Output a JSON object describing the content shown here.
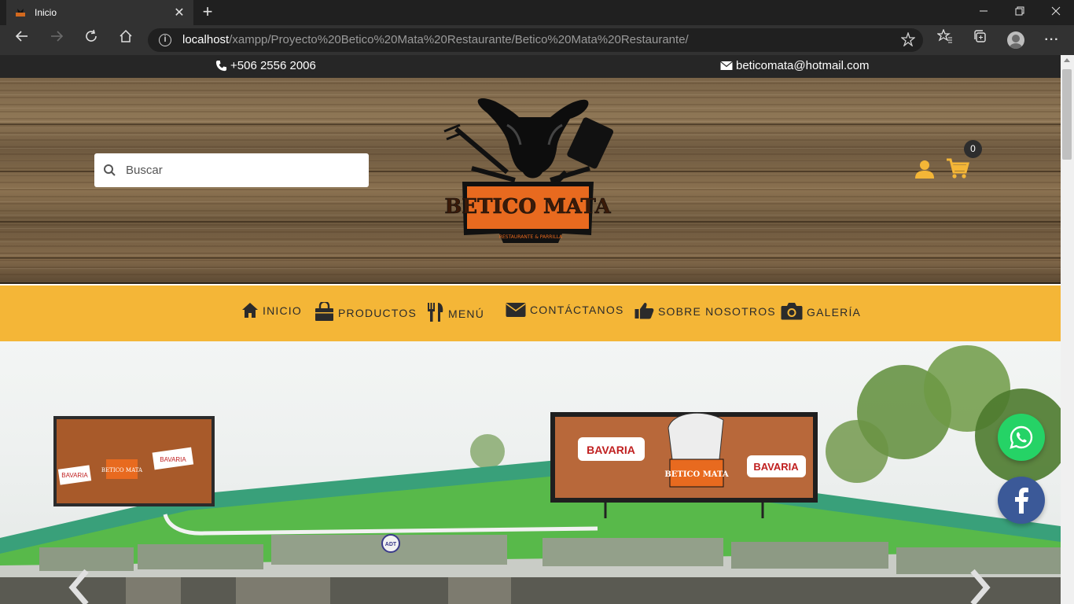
{
  "browser": {
    "tab_title": "Inicio",
    "tab_close": "✕",
    "new_tab": "+",
    "window_controls": {
      "minimize": "—",
      "restore": "❐",
      "close": "✕"
    },
    "nav": {
      "back": "←",
      "forward": "→",
      "reload": "↻",
      "home": "⌂",
      "favorites": "☆",
      "collections": "⧉",
      "more": "···"
    },
    "url_host": "localhost",
    "url_path": "/xampp/Proyecto%20Betico%20Mata%20Restaurante/Betico%20Mata%20Restaurante/",
    "url_info_icon": "i",
    "add_favorite": "☆"
  },
  "topbar": {
    "phone": "+506 2556 2006",
    "email": "beticomata@hotmail.com"
  },
  "header": {
    "search_placeholder": "Buscar",
    "logo_text": "BETICO MATA",
    "logo_subtext": "RESTAURANTE & PARRILLA",
    "cart_count": "0"
  },
  "menu": {
    "items": [
      {
        "label": "INICIO",
        "icon": "home-icon"
      },
      {
        "label": "PRODUCTOS",
        "icon": "shopping-bag-icon"
      },
      {
        "label": "MENÚ",
        "icon": "utensils-icon"
      },
      {
        "label": "CONTÁCTANOS",
        "icon": "envelope-icon"
      },
      {
        "label": "SOBRE NOSOTROS",
        "icon": "thumbs-up-icon"
      },
      {
        "label": "GALERÍA",
        "icon": "camera-icon"
      }
    ]
  },
  "hero": {
    "sign_brand_left": "BAVARIA",
    "sign_brand_right": "BAVARIA",
    "sign_logo": "BETICO MATA",
    "small_sign_left": "BAVARIA",
    "small_sign_mid": "BETICO MATA",
    "small_sign_right": "BAVARIA",
    "adt_badge": "ADT"
  },
  "colors": {
    "menu_bar": "#f4b637",
    "topbar": "#262626",
    "accent_icons": "#f4b637",
    "whatsapp": "#25d366",
    "facebook": "#3b5998"
  }
}
